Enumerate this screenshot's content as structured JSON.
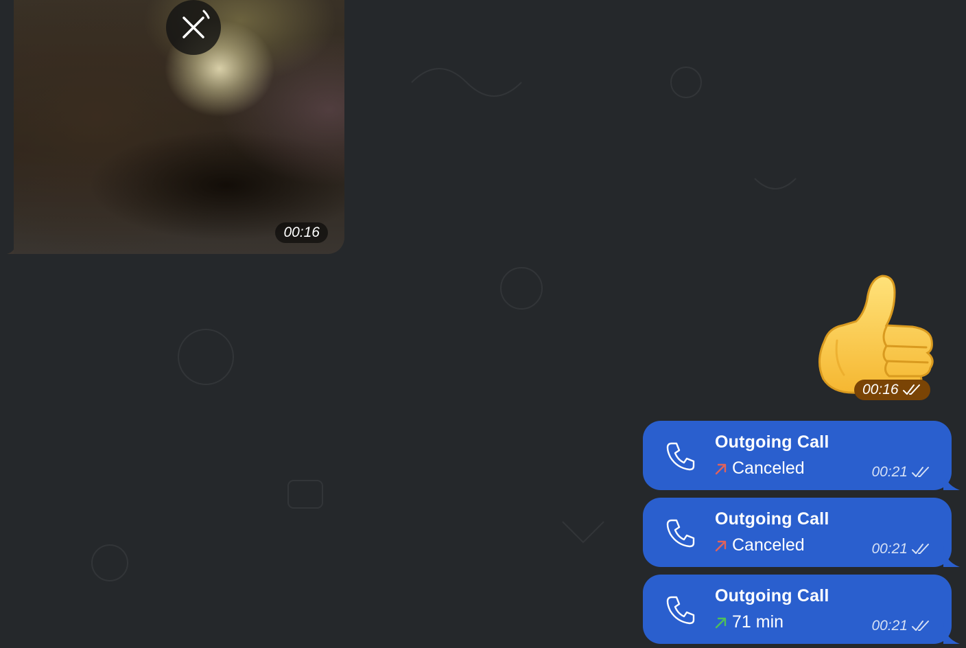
{
  "media_message": {
    "time": "00:16"
  },
  "sticker_message": {
    "emoji": "thumbs-up",
    "time": "00:16"
  },
  "calls": [
    {
      "title": "Outgoing Call",
      "status": "Canceled",
      "arrow_color": "#e2625a",
      "time": "00:21"
    },
    {
      "title": "Outgoing Call",
      "status": "Canceled",
      "arrow_color": "#e2625a",
      "time": "00:21"
    },
    {
      "title": "Outgoing Call",
      "status": "71 min",
      "arrow_color": "#4fc05a",
      "time": "00:21"
    }
  ],
  "colors": {
    "background": "#25282b",
    "outgoing_bubble": "#2a5fce",
    "sticker_time_badge": "#7a4405"
  }
}
